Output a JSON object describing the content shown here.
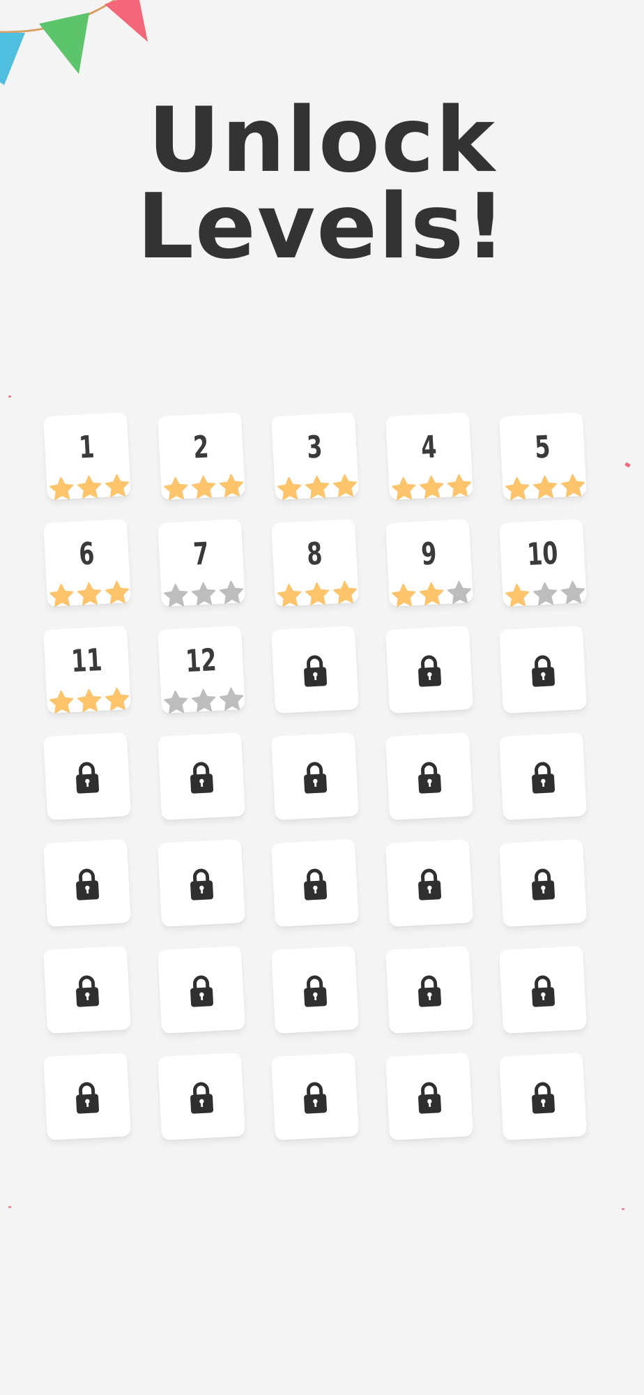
{
  "screen": {
    "title_line1": "Unlock",
    "title_line2": "Levels!"
  },
  "colors": {
    "background": "#f4f4f4",
    "star_on": "#fdc46b",
    "star_off": "#bdbdbd",
    "text": "#333333",
    "bunting": [
      "#4fbfe0",
      "#5cc46a",
      "#f4667a"
    ]
  },
  "levels": [
    {
      "label": "1",
      "locked": false,
      "stars": 3
    },
    {
      "label": "2",
      "locked": false,
      "stars": 3
    },
    {
      "label": "3",
      "locked": false,
      "stars": 3
    },
    {
      "label": "4",
      "locked": false,
      "stars": 3
    },
    {
      "label": "5",
      "locked": false,
      "stars": 3
    },
    {
      "label": "6",
      "locked": false,
      "stars": 3
    },
    {
      "label": "7",
      "locked": false,
      "stars": 0
    },
    {
      "label": "8",
      "locked": false,
      "stars": 3
    },
    {
      "label": "9",
      "locked": false,
      "stars": 2
    },
    {
      "label": "10",
      "locked": false,
      "stars": 1
    },
    {
      "label": "11",
      "locked": false,
      "stars": 3
    },
    {
      "label": "12",
      "locked": false,
      "stars": 0
    },
    {
      "locked": true
    },
    {
      "locked": true
    },
    {
      "locked": true
    },
    {
      "locked": true
    },
    {
      "locked": true
    },
    {
      "locked": true
    },
    {
      "locked": true
    },
    {
      "locked": true
    },
    {
      "locked": true
    },
    {
      "locked": true
    },
    {
      "locked": true
    },
    {
      "locked": true
    },
    {
      "locked": true
    },
    {
      "locked": true
    },
    {
      "locked": true
    },
    {
      "locked": true
    },
    {
      "locked": true
    },
    {
      "locked": true
    },
    {
      "locked": true
    },
    {
      "locked": true
    },
    {
      "locked": true
    },
    {
      "locked": true
    },
    {
      "locked": true
    }
  ]
}
